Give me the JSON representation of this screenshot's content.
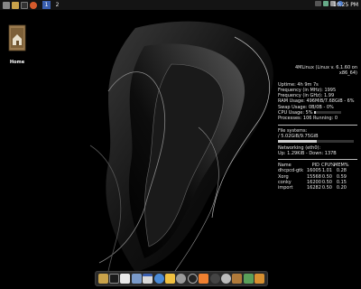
{
  "panel": {
    "workspaces": [
      "1",
      "2"
    ],
    "active_workspace": "1",
    "clock": "10:25 PM"
  },
  "desktop": {
    "icon_label": "Home"
  },
  "conky": {
    "title": "4MLinux (Linux v. 6.1.60 on x86_64)",
    "uptime": "Uptime: 4h 9m 7s",
    "freq_mhz": "Frequency (in MHz): 1995",
    "freq_ghz": "Frequency (in GHz): 1.99",
    "ram": "RAM Usage: 496MiB/7.68GiB - 6%",
    "ram_pct": 6,
    "swap": "Swap Usage: 0B/0B - 0%",
    "swap_pct": 0,
    "cpu": "CPU Usage: 5%",
    "cpu_pct": 5,
    "processes": "Processes: 106  Running: 0",
    "fs_label": "File systems:",
    "fs": "/ 5.02GiB/9.75GiB",
    "fs_pct": 51,
    "net_label": "Networking (eth0):",
    "net": "Up: 1.29KiB - Down: 137B",
    "proc_header": [
      "Name",
      "PID",
      "CPU%",
      "MEM%"
    ],
    "procs": [
      [
        "dhcpcd-gtk",
        "16005",
        "1.01",
        "0.28"
      ],
      [
        "Xorg",
        "15568",
        "0.50",
        "0.59"
      ],
      [
        "conky",
        "16200",
        "0.50",
        "0.15"
      ],
      [
        "import",
        "16282",
        "0.50",
        "0.20"
      ]
    ]
  },
  "colors": {
    "panel_bg": "#141414",
    "workspace_active": "#3a5fb0",
    "dock_bg": "#2a2a2a"
  },
  "dock_icons": [
    "file-manager-icon",
    "terminal-icon",
    "text-editor-icon",
    "image-viewer-icon",
    "calendar-icon",
    "web-browser-icon",
    "mail-icon",
    "settings-icon",
    "media-player-icon",
    "music-icon",
    "video-icon",
    "disc-icon",
    "tools-icon",
    "audio-icon",
    "trash-icon"
  ]
}
